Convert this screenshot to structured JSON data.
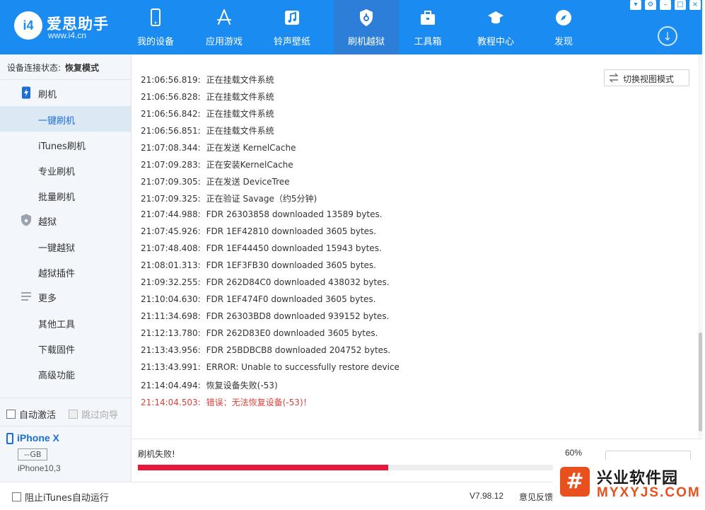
{
  "app": {
    "name": "爱思助手",
    "url": "www.i4.cn",
    "logo_letters": "i4"
  },
  "colors": {
    "brand": "#1a8bf0",
    "error": "#e0403a",
    "progress": "#e8173b",
    "accent": "#1a6fd6"
  },
  "nav": {
    "items": [
      {
        "label": "我的设备",
        "icon": "phone-icon"
      },
      {
        "label": "应用游戏",
        "icon": "app-store-icon"
      },
      {
        "label": "铃声壁纸",
        "icon": "music-icon"
      },
      {
        "label": "刷机越狱",
        "icon": "shield-key-icon",
        "active": true
      },
      {
        "label": "工具箱",
        "icon": "toolbox-icon"
      },
      {
        "label": "教程中心",
        "icon": "graduation-cap-icon"
      },
      {
        "label": "发现",
        "icon": "compass-icon"
      }
    ]
  },
  "sidebar": {
    "status_label": "设备连接状态:",
    "status_value": "恢复模式",
    "groups": [
      {
        "label": "刷机",
        "icon": "flash-phone-icon",
        "items": [
          "一键刷机",
          "iTunes刷机",
          "专业刷机",
          "批量刷机"
        ]
      },
      {
        "label": "越狱",
        "icon": "shield-icon",
        "items": [
          "一键越狱",
          "越狱插件"
        ]
      },
      {
        "label": "更多",
        "icon": "menu-lines-icon",
        "items": [
          "其他工具",
          "下载固件",
          "高级功能"
        ]
      }
    ],
    "active_item": "一键刷机",
    "auto_activate": "自动激活",
    "skip_guide": "跳过向导",
    "device": {
      "name": "iPhone X",
      "capacity": "--GB",
      "model": "iPhone10,3"
    }
  },
  "log": {
    "lines": [
      {
        "time": "21:06:56.819:",
        "msg": "正在挂载文件系统"
      },
      {
        "time": "21:06:56.828:",
        "msg": "正在挂载文件系统"
      },
      {
        "time": "21:06:56.842:",
        "msg": "正在挂载文件系统"
      },
      {
        "time": "21:06:56.851:",
        "msg": "正在挂载文件系统"
      },
      {
        "time": "21:07:08.344:",
        "msg": "正在发送 KernelCache"
      },
      {
        "time": "21:07:09.283:",
        "msg": "正在安装KernelCache"
      },
      {
        "time": "21:07:09.305:",
        "msg": "正在发送 DeviceTree"
      },
      {
        "time": "21:07:09.325:",
        "msg": "正在验证 Savage（约5分钟)"
      },
      {
        "time": "21:07:44.988:",
        "msg": "FDR 26303858 downloaded 13589 bytes."
      },
      {
        "time": "21:07:45.926:",
        "msg": "FDR 1EF42810 downloaded 3605 bytes."
      },
      {
        "time": "21:07:48.408:",
        "msg": "FDR 1EF44450 downloaded 15943 bytes."
      },
      {
        "time": "21:08:01.313:",
        "msg": "FDR 1EF3FB30 downloaded 3605 bytes."
      },
      {
        "time": "21:09:32.255:",
        "msg": "FDR 262D84C0 downloaded 438032 bytes."
      },
      {
        "time": "21:10:04.630:",
        "msg": "FDR 1EF474F0 downloaded 3605 bytes."
      },
      {
        "time": "21:11:34.698:",
        "msg": "FDR 26303BD8 downloaded 939152 bytes."
      },
      {
        "time": "21:12:13.780:",
        "msg": "FDR 262D83E0 downloaded 3605 bytes."
      },
      {
        "time": "21:13:43.956:",
        "msg": "FDR 25BDBCB8 downloaded 204752 bytes."
      },
      {
        "time": "21:13:43.991:",
        "msg": "ERROR: Unable to successfully restore device"
      },
      {
        "time": "21:14:04.494:",
        "msg": "恢复设备失败(-53)"
      },
      {
        "time": "21:14:04.503:",
        "msg": "错误：无法恢复设备(-53)！",
        "error": true
      }
    ]
  },
  "switch_view": "切换视图模式",
  "progress": {
    "status": "刷机失败!",
    "percent_text": "60%",
    "percent": 0.6
  },
  "footer": {
    "block_itunes": "阻止iTunes自动运行",
    "version": "V7.98.12",
    "feedback": "意见反馈"
  },
  "watermark": {
    "cn": "兴业软件园",
    "en": "MYXYJS.COM",
    "badge": "#"
  }
}
